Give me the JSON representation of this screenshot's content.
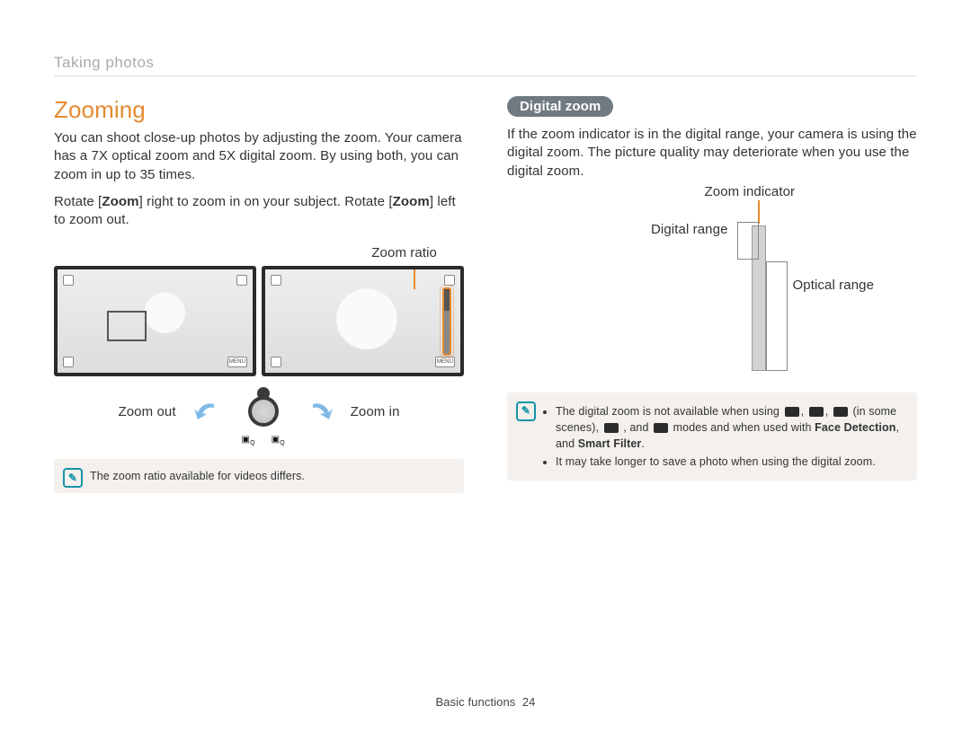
{
  "breadcrumb": "Taking photos",
  "left": {
    "heading": "Zooming",
    "intro": "You can shoot close-up photos by adjusting the zoom. Your camera has a 7X optical zoom and 5X digital zoom. By using both, you can zoom in up to 35 times.",
    "rotate_pre": "Rotate [",
    "rotate_b1": "Zoom",
    "rotate_mid1": "] right to zoom in on your subject. Rotate [",
    "rotate_b2": "Zoom",
    "rotate_post": "] left to zoom out.",
    "zoom_ratio_label": "Zoom ratio",
    "zoom_out": "Zoom out",
    "zoom_in": "Zoom in",
    "menu": "MENU",
    "note": "The zoom ratio available for videos differs."
  },
  "right": {
    "pill": "Digital zoom",
    "intro": "If the zoom indicator is in the digital range, your camera is using the digital zoom. The picture quality may deteriorate when you use the digital zoom.",
    "zoom_indicator": "Zoom indicator",
    "digital_range": "Digital range",
    "optical_range": "Optical range",
    "note1_pre": "The digital zoom is not available when using ",
    "note1_mid": " (in some scenes), ",
    "note1_mid2": ", and ",
    "note1_post1": " modes and when used with ",
    "note1_b1": "Face Detection",
    "note1_sep": ", and ",
    "note1_b2": "Smart Filter",
    "note1_end": ".",
    "note2": "It may take longer to save a photo when using the digital zoom."
  },
  "footer": {
    "section": "Basic functions",
    "page": "24"
  }
}
